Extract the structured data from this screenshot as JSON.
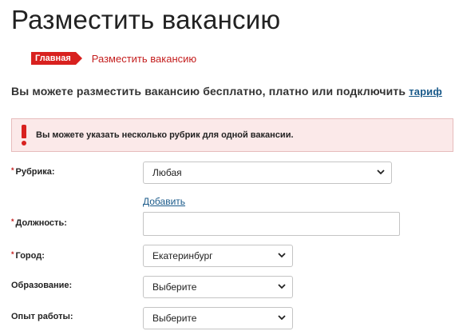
{
  "page": {
    "title": "Разместить вакансию"
  },
  "breadcrumb": {
    "home": "Главная",
    "current": "Разместить вакансию"
  },
  "intro": {
    "text": "Вы можете разместить вакансию бесплатно, платно или подключить ",
    "link": "тариф"
  },
  "alert": {
    "icon": "exclamation-icon",
    "text": "Вы можете указать несколько рубрик для одной вакансии."
  },
  "form": {
    "required_mark": "*",
    "rubric": {
      "label": "Рубрика:",
      "value": "Любая",
      "add_label": "Добавить"
    },
    "position": {
      "label": "Должность:",
      "value": ""
    },
    "city": {
      "label": "Город:",
      "value": "Екатеринбург"
    },
    "education": {
      "label": "Образование:",
      "value": "Выберите"
    },
    "experience": {
      "label": "Опыт работы:",
      "value": "Выберите"
    }
  },
  "colors": {
    "accent": "#d8211f",
    "link": "#1a5a8a",
    "alert_bg": "#fbe9e9"
  }
}
